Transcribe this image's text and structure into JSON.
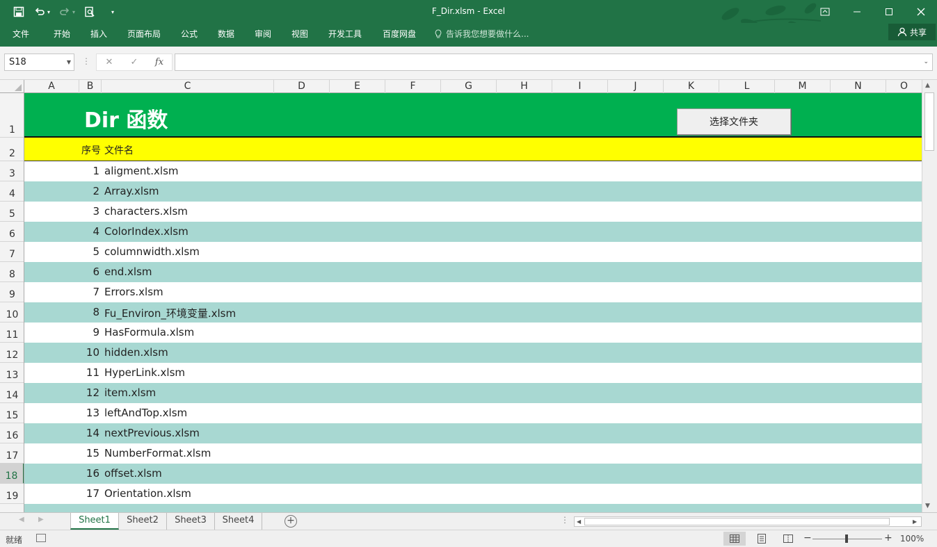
{
  "window": {
    "title": "F_Dir.xlsm  -  Excel",
    "share_label": "共享"
  },
  "ribbon": {
    "tabs": [
      "文件",
      "开始",
      "插入",
      "页面布局",
      "公式",
      "数据",
      "审阅",
      "视图",
      "开发工具",
      "百度网盘"
    ],
    "tell_me": "告诉我您想要做什么..."
  },
  "formula_bar": {
    "name_box": "S18",
    "fx_label": "fx",
    "formula": ""
  },
  "columns": [
    "A",
    "B",
    "C",
    "D",
    "E",
    "F",
    "G",
    "H",
    "I",
    "J",
    "K",
    "L",
    "M",
    "N",
    "O"
  ],
  "row_numbers": [
    "1",
    "2",
    "3",
    "4",
    "5",
    "6",
    "7",
    "8",
    "9",
    "10",
    "11",
    "12",
    "13",
    "14",
    "15",
    "16",
    "17",
    "18",
    "19"
  ],
  "selected_row": "18",
  "sheet": {
    "banner_title": "Dir 函数",
    "button_label": "选择文件夹",
    "header_num": "序号",
    "header_name": "文件名",
    "rows": [
      {
        "n": "1",
        "file": "aligment.xlsm"
      },
      {
        "n": "2",
        "file": "Array.xlsm"
      },
      {
        "n": "3",
        "file": "characters.xlsm"
      },
      {
        "n": "4",
        "file": "ColorIndex.xlsm"
      },
      {
        "n": "5",
        "file": "columnwidth.xlsm"
      },
      {
        "n": "6",
        "file": "end.xlsm"
      },
      {
        "n": "7",
        "file": "Errors.xlsm"
      },
      {
        "n": "8",
        "file": "Fu_Environ_环境变量.xlsm"
      },
      {
        "n": "9",
        "file": "HasFormula.xlsm"
      },
      {
        "n": "10",
        "file": "hidden.xlsm"
      },
      {
        "n": "11",
        "file": "HyperLink.xlsm"
      },
      {
        "n": "12",
        "file": "item.xlsm"
      },
      {
        "n": "13",
        "file": "leftAndTop.xlsm"
      },
      {
        "n": "14",
        "file": "nextPrevious.xlsm"
      },
      {
        "n": "15",
        "file": "NumberFormat.xlsm"
      },
      {
        "n": "16",
        "file": "offset.xlsm"
      },
      {
        "n": "17",
        "file": "Orientation.xlsm"
      }
    ],
    "colors": {
      "banner": "#00b050",
      "header": "#ffff00",
      "alt_row": "#a8d8d2"
    }
  },
  "sheet_tabs": [
    "Sheet1",
    "Sheet2",
    "Sheet3",
    "Sheet4"
  ],
  "active_sheet": "Sheet1",
  "status": {
    "ready": "就绪",
    "zoom": "100%"
  }
}
